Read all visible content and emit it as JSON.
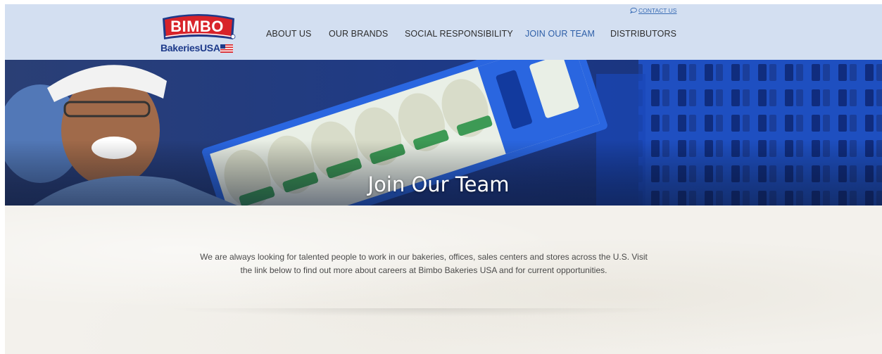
{
  "brand": {
    "logo_word": "BIMBO",
    "logo_sub": "BakeriesUSA",
    "colors": {
      "logo_red": "#d8232a",
      "logo_blue": "#1d3a8a"
    }
  },
  "header": {
    "background": "#d3dff1",
    "contact": {
      "icon": "chat-bubble-icon",
      "label": "CONTACT US"
    },
    "nav": [
      {
        "label": "ABOUT US",
        "active": false
      },
      {
        "label": "OUR BRANDS",
        "active": false
      },
      {
        "label": "SOCIAL RESPONSIBILITY",
        "active": false
      },
      {
        "label": "JOIN OUR TEAM",
        "active": true
      },
      {
        "label": "DISTRIBUTORS",
        "active": false
      }
    ],
    "active_color": "#2e5fa8"
  },
  "hero": {
    "title": "Join Our Team"
  },
  "main": {
    "intro": "We are always looking for talented people to work in our bakeries, offices, sales centers and stores across the U.S. Visit the link below to find out more about careers at Bimbo Bakeries USA and for current opportunities."
  }
}
